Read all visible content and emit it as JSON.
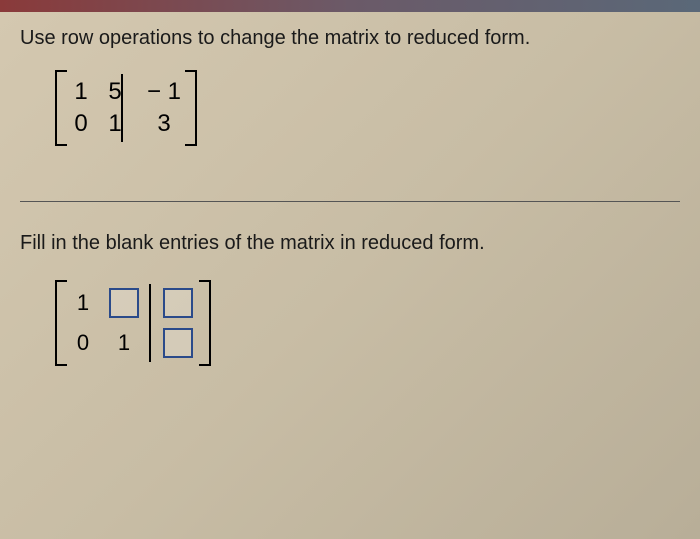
{
  "top": {
    "instruction": "Use row operations to change the matrix to reduced form."
  },
  "source_matrix": {
    "r1c1": "1",
    "r1c2": "5",
    "r1c3": "− 1",
    "r2c1": "0",
    "r2c2": "1",
    "r2c3": "3"
  },
  "bottom": {
    "instruction": "Fill in the blank entries of the matrix in reduced form."
  },
  "answer_matrix": {
    "r1c1": "1",
    "r2c1": "0",
    "r2c2": "1"
  }
}
